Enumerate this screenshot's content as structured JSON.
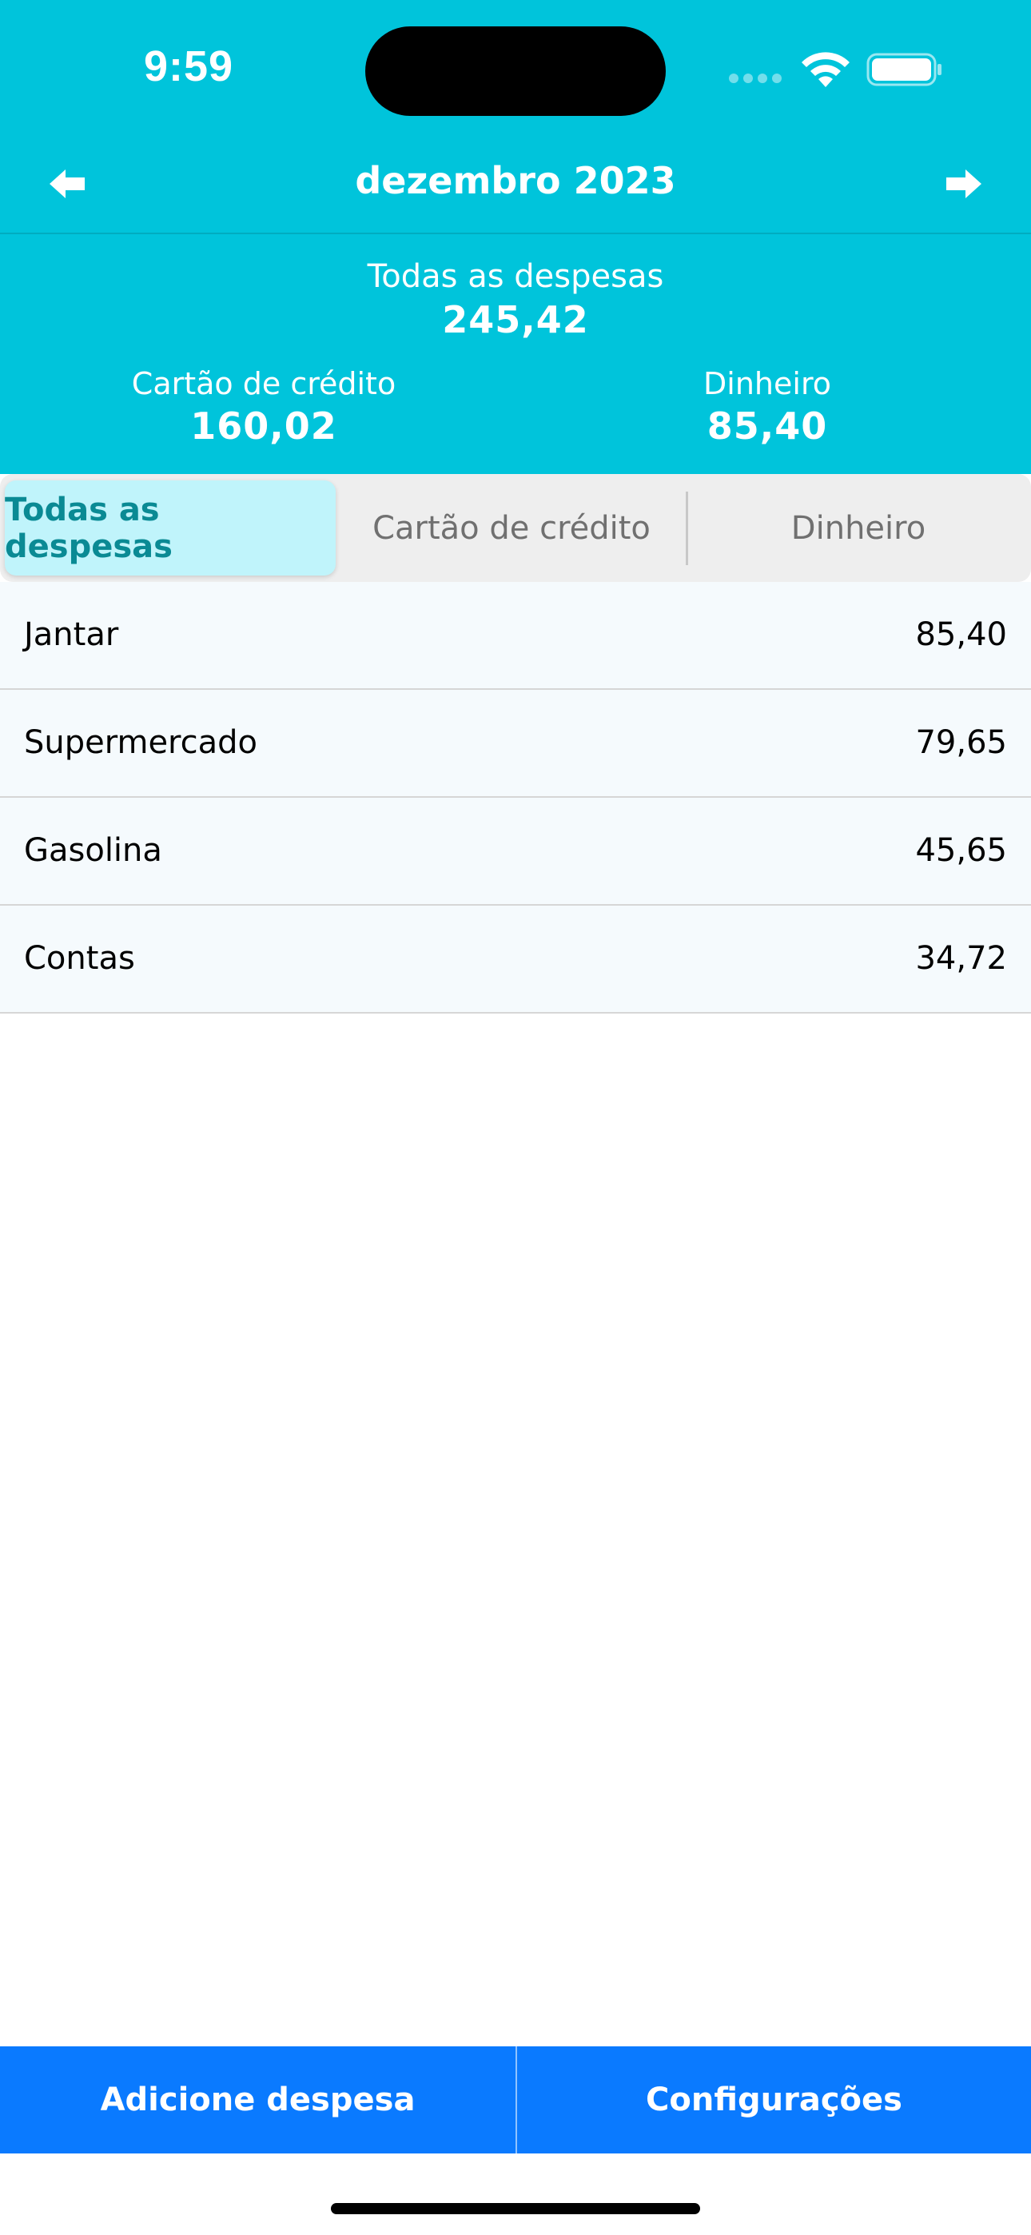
{
  "status_bar": {
    "time": "9:59"
  },
  "header": {
    "month_title": "dezembro 2023",
    "total_label": "Todas as despesas",
    "total_value": "245,42",
    "credit_label": "Cartão de crédito",
    "credit_value": "160,02",
    "cash_label": "Dinheiro",
    "cash_value": "85,40"
  },
  "segmented": {
    "tabs": [
      {
        "label": "Todas as despesas",
        "selected": true
      },
      {
        "label": "Cartão de crédito",
        "selected": false
      },
      {
        "label": "Dinheiro",
        "selected": false
      }
    ]
  },
  "expenses": [
    {
      "name": "Jantar",
      "amount": "85,40"
    },
    {
      "name": "Supermercado",
      "amount": "79,65"
    },
    {
      "name": "Gasolina",
      "amount": "45,65"
    },
    {
      "name": "Contas",
      "amount": "34,72"
    }
  ],
  "bottom_bar": {
    "add_label": "Adicione despesa",
    "settings_label": "Configurações"
  },
  "icons": {
    "prev": "arrow-left-icon",
    "next": "arrow-right-icon",
    "wifi": "wifi-icon",
    "battery": "battery-icon",
    "signal": "cellular-signal-icon"
  },
  "colors": {
    "header_bg": "#00C4DB",
    "segment_active_bg": "#C0F4FB",
    "segment_active_text": "#0A8A94",
    "row_bg": "#F5FAFD",
    "bottom_bar_bg": "#0A7AFF"
  }
}
